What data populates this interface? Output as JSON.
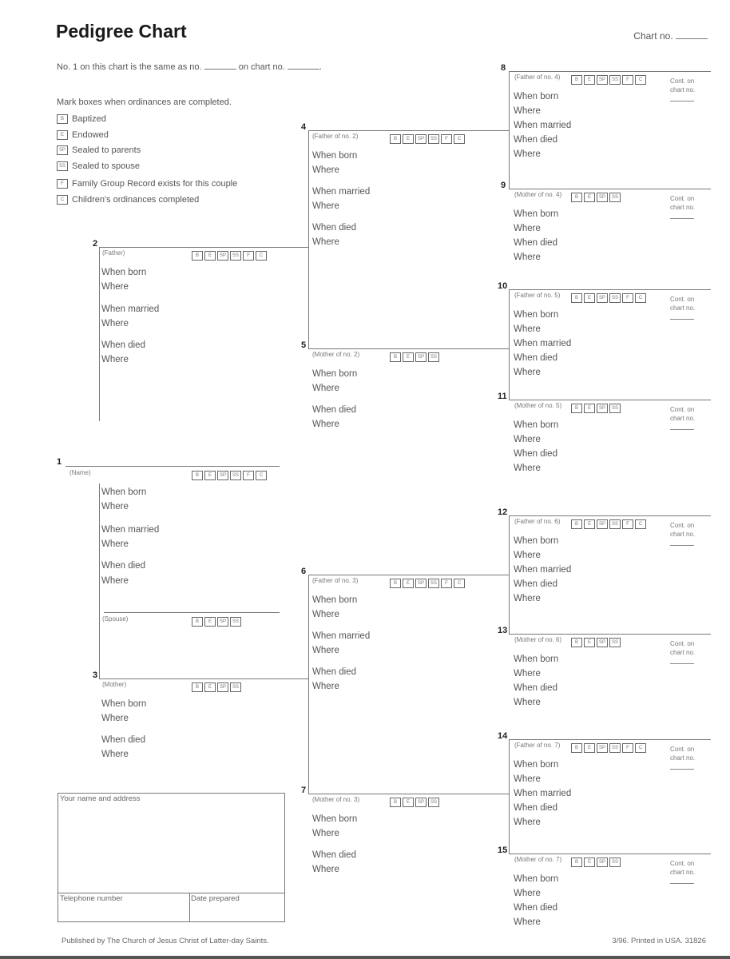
{
  "header": {
    "title": "Pedigree Chart",
    "chart_no_label": "Chart no.",
    "same_as_prefix": "No. 1 on this chart is the same as no.",
    "same_as_middle": "on chart no.",
    "same_as_suffix": "."
  },
  "legend": {
    "title": "Mark boxes when ordinances are completed.",
    "items": [
      {
        "code": "B",
        "label": "Baptized"
      },
      {
        "code": "E",
        "label": "Endowed"
      },
      {
        "code": "SP",
        "label": "Sealed to parents"
      },
      {
        "code": "SS",
        "label": "Sealed to spouse"
      },
      {
        "code": "F",
        "label": "Family Group Record exists for this couple"
      },
      {
        "code": "C",
        "label": "Children's ordinances completed"
      }
    ]
  },
  "ordinance_codes": {
    "full": [
      "B",
      "E",
      "SP",
      "SS",
      "F",
      "C"
    ],
    "short": [
      "B",
      "E",
      "SP",
      "SS"
    ]
  },
  "fields": {
    "when_born": "When born",
    "where": "Where",
    "when_married": "When married",
    "when_died": "When died"
  },
  "cont_on_chart": "Cont. on chart no.",
  "persons": [
    {
      "no": "1",
      "label": "(Name)"
    },
    {
      "no": "2",
      "label": "(Father)"
    },
    {
      "no": "3",
      "label": "(Mother)"
    },
    {
      "no": "4",
      "label": "(Father of no. 2)"
    },
    {
      "no": "5",
      "label": "(Mother of no. 2)"
    },
    {
      "no": "6",
      "label": "(Father of no. 3)"
    },
    {
      "no": "7",
      "label": "(Mother of no. 3)"
    },
    {
      "no": "8",
      "label": "(Father of no. 4)"
    },
    {
      "no": "9",
      "label": "(Mother of no. 4)"
    },
    {
      "no": "10",
      "label": "(Father of no. 5)"
    },
    {
      "no": "11",
      "label": "(Mother of no. 5)"
    },
    {
      "no": "12",
      "label": "(Father of no. 6)"
    },
    {
      "no": "13",
      "label": "(Mother of no. 6)"
    },
    {
      "no": "14",
      "label": "(Father of no. 7)"
    },
    {
      "no": "15",
      "label": "(Mother of no. 7)"
    }
  ],
  "spouse_label": "(Spouse)",
  "address_box": {
    "name_address": "Your name and address",
    "telephone": "Telephone number",
    "date_prepared": "Date prepared"
  },
  "footer": {
    "publisher": "Published by The Church of Jesus Christ of Latter-day Saints.",
    "printing": "3/96. Printed in USA. 31826"
  }
}
